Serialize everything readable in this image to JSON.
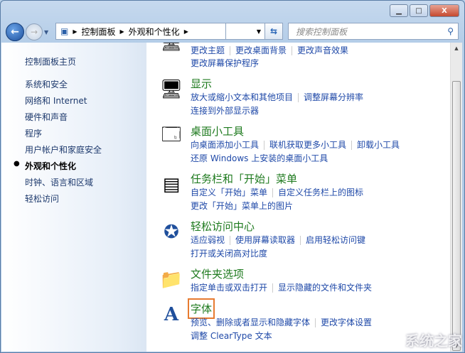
{
  "window": {
    "min": "▁",
    "max": "□",
    "close": "X"
  },
  "address": {
    "root": "控制面板",
    "current": "外观和个性化"
  },
  "search": {
    "placeholder": "搜索控制面板"
  },
  "sidebar": {
    "items": [
      {
        "label": "控制面板主页"
      },
      {
        "label": "系统和安全"
      },
      {
        "label": "网络和 Internet"
      },
      {
        "label": "硬件和声音"
      },
      {
        "label": "程序"
      },
      {
        "label": "用户帐户和家庭安全"
      },
      {
        "label": "外观和个性化",
        "current": true
      },
      {
        "label": "时钟、语言和区域"
      },
      {
        "label": "轻松访问"
      }
    ]
  },
  "categories": [
    {
      "title": "",
      "icon": "personalization-icon",
      "rows": [
        [
          "更改主题",
          "更改桌面背景",
          "更改声音效果"
        ],
        [
          "更改屏幕保护程序"
        ]
      ]
    },
    {
      "title": "显示",
      "icon": "display-icon",
      "rows": [
        [
          "放大或缩小文本和其他项目",
          "调整屏幕分辨率"
        ],
        [
          "连接到外部显示器"
        ]
      ]
    },
    {
      "title": "桌面小工具",
      "icon": "gadgets-icon",
      "rows": [
        [
          "向桌面添加小工具",
          "联机获取更多小工具",
          "卸载小工具"
        ],
        [
          "还原 Windows 上安装的桌面小工具"
        ]
      ]
    },
    {
      "title": "任务栏和「开始」菜单",
      "icon": "taskbar-icon",
      "rows": [
        [
          "自定义「开始」菜单",
          "自定义任务栏上的图标"
        ],
        [
          "更改「开始」菜单上的图片"
        ]
      ]
    },
    {
      "title": "轻松访问中心",
      "icon": "ease-of-access-icon",
      "rows": [
        [
          "适应弱视",
          "使用屏幕读取器",
          "启用轻松访问键"
        ],
        [
          "打开或关闭高对比度"
        ]
      ]
    },
    {
      "title": "文件夹选项",
      "icon": "folder-options-icon",
      "rows": [
        [
          "指定单击或双击打开",
          "显示隐藏的文件和文件夹"
        ]
      ]
    },
    {
      "title": "字体",
      "icon": "fonts-icon",
      "rows": [
        [
          "预览、删除或者显示和隐藏字体",
          "更改字体设置"
        ],
        [
          "调整 ClearType 文本"
        ]
      ]
    }
  ],
  "watermark": "系统之家",
  "colors": {
    "highlight": "#e77b30",
    "link": "#1f49a8",
    "title": "#1e7a1e"
  }
}
